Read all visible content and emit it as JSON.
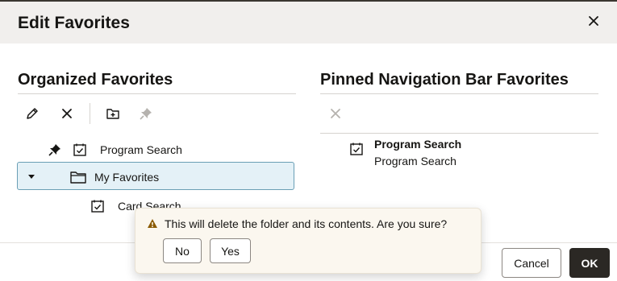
{
  "dialog": {
    "title": "Edit Favorites"
  },
  "left": {
    "title": "Organized Favorites",
    "toolbar": {
      "edit": "pencil-icon",
      "delete": "close-icon",
      "new_folder": "add-folder-icon",
      "pin": "pin-icon"
    },
    "tree": [
      {
        "label": "Program Search",
        "pinned": true,
        "icon": "calendar-check-icon"
      },
      {
        "label": "My Favorites",
        "expanded": true,
        "selected": true,
        "icon": "folder-icon"
      },
      {
        "label": "Card Search",
        "icon": "calendar-check-icon"
      }
    ]
  },
  "right": {
    "title": "Pinned Navigation Bar Favorites",
    "items": [
      {
        "title": "Program Search",
        "subtitle": "Program Search",
        "icon": "calendar-check-icon"
      }
    ]
  },
  "confirm": {
    "message": "This will delete the folder and its contents. Are you sure?",
    "no_label": "No",
    "yes_label": "Yes",
    "colors": {
      "warning": "#8a5a00"
    }
  },
  "footer": {
    "cancel_label": "Cancel",
    "ok_label": "OK"
  }
}
